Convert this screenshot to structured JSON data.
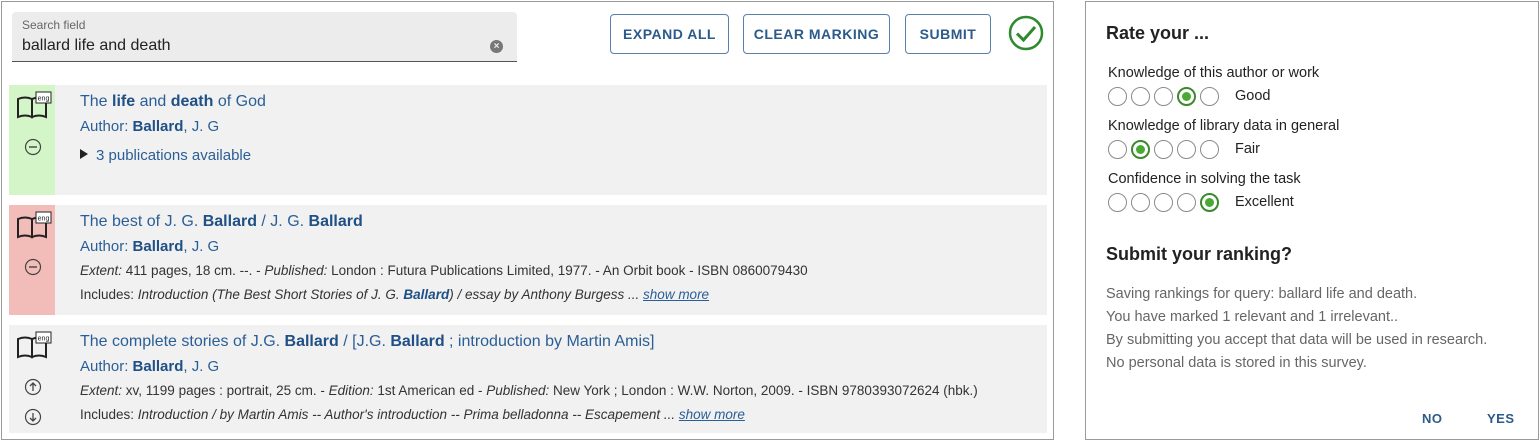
{
  "search": {
    "label": "Search field",
    "value": "ballard life and death"
  },
  "toolbar": {
    "expand_all": "EXPAND ALL",
    "clear_marking": "CLEAR MARKING",
    "submit": "SUBMIT"
  },
  "results": [
    {
      "language": "eng",
      "marking": "relevant",
      "title_parts": [
        "The ",
        "life",
        " and ",
        "death",
        " of God"
      ],
      "author_label": "Author: ",
      "author_last": "Ballard",
      "author_rest": ", J. G",
      "publications": "3 publications available"
    },
    {
      "language": "eng",
      "marking": "irrelevant",
      "title_parts": [
        "The best of J. G. ",
        "Ballard",
        " / J. G. ",
        "Ballard"
      ],
      "author_label": "Author: ",
      "author_last": "Ballard",
      "author_rest": ", J. G",
      "extent_label": "Extent:",
      "extent": " 411 pages, 18 cm. --. - ",
      "published_label": "Published:",
      "published": " London : Futura Publications Limited, 1977. - An Orbit book - ISBN 0860079430",
      "includes_label": "Includes: ",
      "includes_pre": "Introduction (The Best Short Stories of J. G. ",
      "includes_hl": "Ballard",
      "includes_post": ") / essay by Anthony Burgess ... ",
      "show_more": "show more"
    },
    {
      "language": "eng",
      "marking": "none",
      "title_parts": [
        "The complete stories of J.G. ",
        "Ballard",
        " / [J.G. ",
        "Ballard",
        " ; introduction by Martin Amis]"
      ],
      "author_label": "Author: ",
      "author_last": "Ballard",
      "author_rest": ", J. G",
      "extent_label": "Extent:",
      "extent": " xv, 1199 pages : portrait, 25 cm. - ",
      "edition_label": "Edition:",
      "edition": " 1st American ed - ",
      "published_label": "Published:",
      "published": " New York ; London : W.W. Norton, 2009. - ISBN 9780393072624 (hbk.)",
      "includes_label": "Includes: ",
      "includes_text": "Introduction / by Martin Amis -- Author's introduction -- Prima belladonna -- Escapement ... ",
      "show_more": "show more"
    }
  ],
  "rating": {
    "title": "Rate your ...",
    "questions": [
      {
        "label": "Knowledge of this author or work",
        "selected_index": 3,
        "value_label": "Good"
      },
      {
        "label": "Knowledge of library data in general",
        "selected_index": 1,
        "value_label": "Fair"
      },
      {
        "label": "Confidence in solving the task",
        "selected_index": 4,
        "value_label": "Excellent"
      }
    ]
  },
  "submit_panel": {
    "title": "Submit your ranking?",
    "lines": [
      "Saving rankings for query: ballard life and death.",
      "You have marked 1 relevant and 1 irrelevant..",
      "By submitting you accept that data will be used in research.",
      "No personal data is stored in this survey."
    ],
    "no": "NO",
    "yes": "YES"
  },
  "colors": {
    "relevant": "#d3f5c8",
    "irrelevant": "#f2bdb8",
    "accent": "#2a5e96",
    "radio_selected": "#4aa834"
  },
  "icons": [
    "clear-icon",
    "check-circle-icon",
    "book-icon",
    "minus-circle-icon",
    "arrow-up-circle-icon",
    "arrow-down-circle-icon"
  ]
}
